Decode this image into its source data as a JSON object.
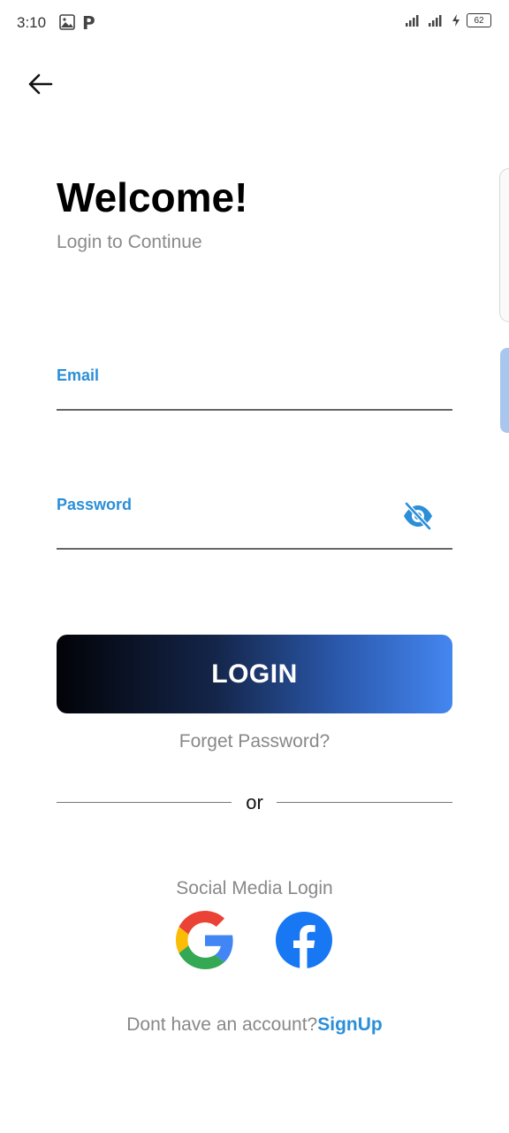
{
  "status_bar": {
    "time": "3:10",
    "battery": "62",
    "icons": [
      "gallery-icon",
      "p-icon",
      "signal-icon",
      "signal-icon",
      "charging-icon",
      "battery-icon"
    ]
  },
  "header": {
    "back_icon": "arrow-left-icon"
  },
  "welcome": {
    "title": "Welcome!",
    "subtitle": "Login to Continue"
  },
  "form": {
    "email_label": "Email",
    "email_value": "",
    "password_label": "Password",
    "password_value": "",
    "visibility_icon": "eye-off-icon"
  },
  "actions": {
    "login_label": "LOGIN",
    "forgot_label": "Forget Password?",
    "or_label": "or"
  },
  "social": {
    "label": "Social Media Login",
    "providers": [
      "google-icon",
      "facebook-icon"
    ]
  },
  "footer": {
    "prompt": "Dont have an account?",
    "signup_label": "SignUp"
  },
  "colors": {
    "accent": "#2a8fd8",
    "gradient_start": "#020307",
    "gradient_end": "#4486f0",
    "muted_text": "#888888"
  }
}
